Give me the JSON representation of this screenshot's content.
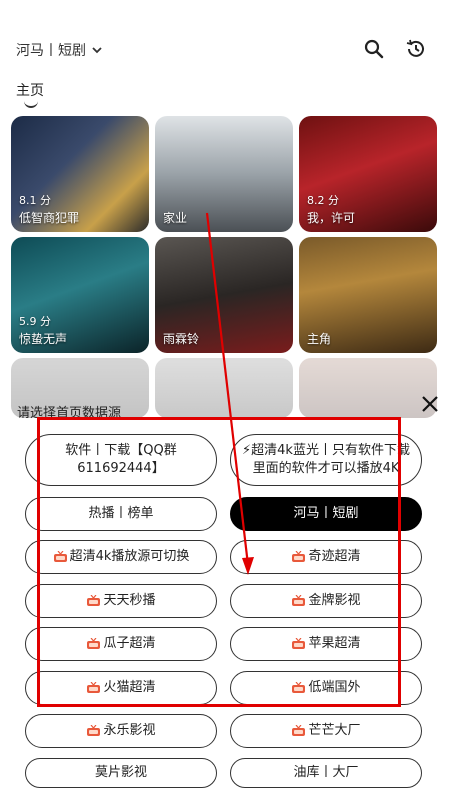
{
  "header": {
    "source_label": "河马丨短剧",
    "home_tab": "主页"
  },
  "cards": [
    {
      "title": "低智商犯罪",
      "rating": "8.1 分"
    },
    {
      "title": "家业",
      "rating": ""
    },
    {
      "title": "我，许可",
      "rating": "8.2 分"
    },
    {
      "title": "惊蛰无声",
      "rating": "5.9 分"
    },
    {
      "title": "雨霖铃",
      "rating": ""
    },
    {
      "title": "主角",
      "rating": ""
    }
  ],
  "sheet": {
    "title": "请选择首页数据源",
    "options": [
      {
        "label": "软件丨下载【QQ群611692444】"
      },
      {
        "label": "⚡超清4k蓝光丨只有软件下载里面的软件才可以播放4K"
      },
      {
        "label": "热播丨榜单"
      },
      {
        "label": "河马丨短剧",
        "selected": true
      },
      {
        "label": "超清4k播放源可切换"
      },
      {
        "label": "奇迹超清"
      },
      {
        "label": "天天秒播"
      },
      {
        "label": "金牌影视"
      },
      {
        "label": "瓜子超清"
      },
      {
        "label": "苹果超清"
      },
      {
        "label": "火猫超清"
      },
      {
        "label": "低端国外"
      },
      {
        "label": "永乐影视"
      },
      {
        "label": "芒芒大厂"
      },
      {
        "label": "莫片影视"
      },
      {
        "label": "油库丨大厂"
      }
    ]
  },
  "colors": {
    "annotation_red": "#e00000",
    "selected_bg": "#000000"
  }
}
